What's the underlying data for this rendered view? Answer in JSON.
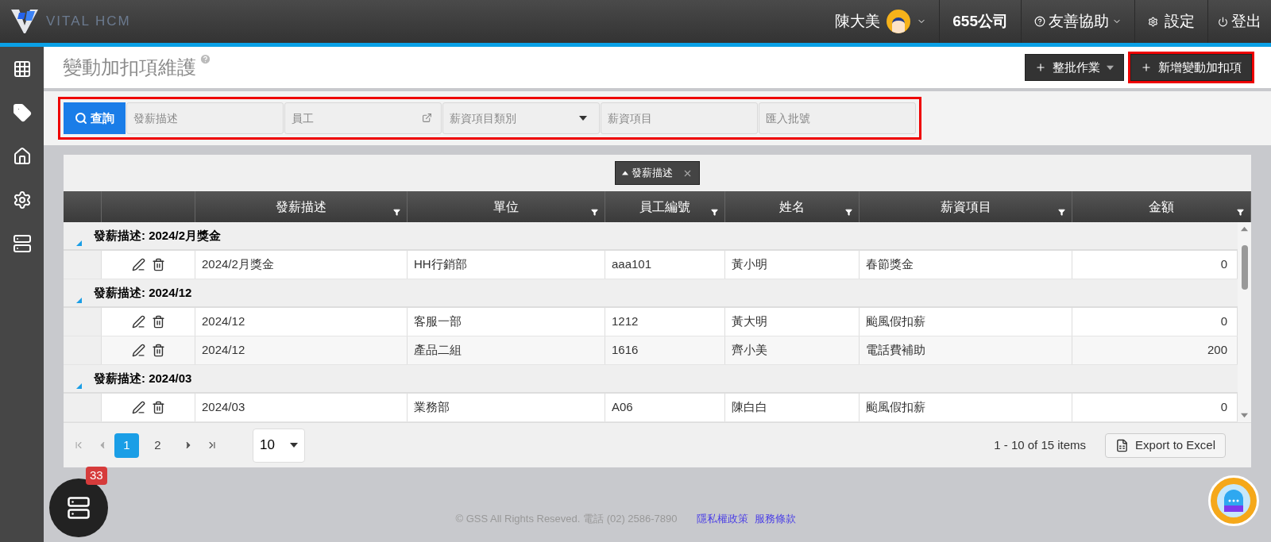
{
  "topbar": {
    "logo_text": "VITAL HCM",
    "user": "陳大美",
    "company": "655公司",
    "help": "友善協助",
    "settings": "設定",
    "logout": "登出"
  },
  "page": {
    "title": "變動加扣項維護",
    "batch_button": "整批作業",
    "add_button": "新增變動加扣項"
  },
  "filters": {
    "search_button": "查詢",
    "fields": [
      {
        "kind": "text",
        "placeholder": "發薪描述"
      },
      {
        "kind": "picker",
        "placeholder": "員工"
      },
      {
        "kind": "dropdown",
        "placeholder": "薪資項目類別"
      },
      {
        "kind": "text",
        "placeholder": "薪資項目"
      },
      {
        "kind": "text",
        "placeholder": "匯入批號"
      }
    ]
  },
  "group_chip": {
    "label": "發薪描述"
  },
  "table": {
    "columns": [
      "發薪描述",
      "單位",
      "員工編號",
      "姓名",
      "薪資項目",
      "金額"
    ],
    "groups": [
      {
        "label": "發薪描述: 2024/2月獎金",
        "expanded": true,
        "rows": [
          [
            "2024/2月獎金",
            "HH行銷部",
            "aaa101",
            "黃小明",
            "春節獎金",
            "0"
          ]
        ]
      },
      {
        "label": "發薪描述: 2024/12",
        "expanded": true,
        "rows": [
          [
            "2024/12",
            "客服一部",
            "1212",
            "黃大明",
            "颱風假扣薪",
            "0"
          ],
          [
            "2024/12",
            "產品二組",
            "1616",
            "齊小美",
            "電話費補助",
            "200"
          ]
        ]
      },
      {
        "label": "發薪描述: 2024/03",
        "expanded": true,
        "rows": [
          [
            "2024/03",
            "業務部",
            "A06",
            "陳白白",
            "颱風假扣薪",
            "0"
          ]
        ]
      }
    ]
  },
  "pager": {
    "pages": [
      {
        "label": "1",
        "selected": true
      },
      {
        "label": "2",
        "selected": false
      }
    ],
    "page_size": "10",
    "summary": "1 - 10 of 15 items",
    "export": "Export to Excel"
  },
  "fab": {
    "badge": "33"
  },
  "footer": {
    "copyright": "© GSS All Rights Reseved. 電話 (02) 2586-7890",
    "links": [
      "隱私權政策",
      "服務條款"
    ]
  }
}
